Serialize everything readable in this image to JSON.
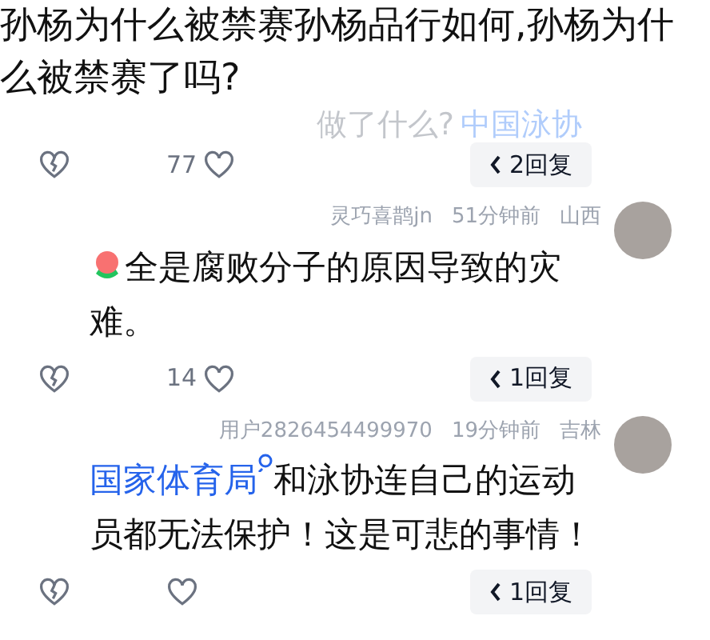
{
  "title": "孙杨为什么被禁赛孙杨品行如何,孙杨为什么被禁赛了吗?",
  "faded_comment": {
    "link": "中国泳协",
    "text": "做了什么?"
  },
  "comments": [
    {
      "actions": {
        "likes": "77",
        "replies": "2回复"
      }
    },
    {
      "user": "灵巧喜鹊jn",
      "time": "51分钟前",
      "location": "山西",
      "has_flower": true,
      "text": "全是腐败分子的原因导致的灾难。",
      "actions": {
        "likes": "14",
        "replies": "1回复"
      }
    },
    {
      "user": "用户2826454499970",
      "time": "19分钟前",
      "location": "吉林",
      "has_flower": false,
      "link": "国家体育局",
      "text": "和泳协连自己的运动员都无法保护！这是可悲的事情！",
      "actions": {
        "replies": "1回复"
      }
    }
  ]
}
